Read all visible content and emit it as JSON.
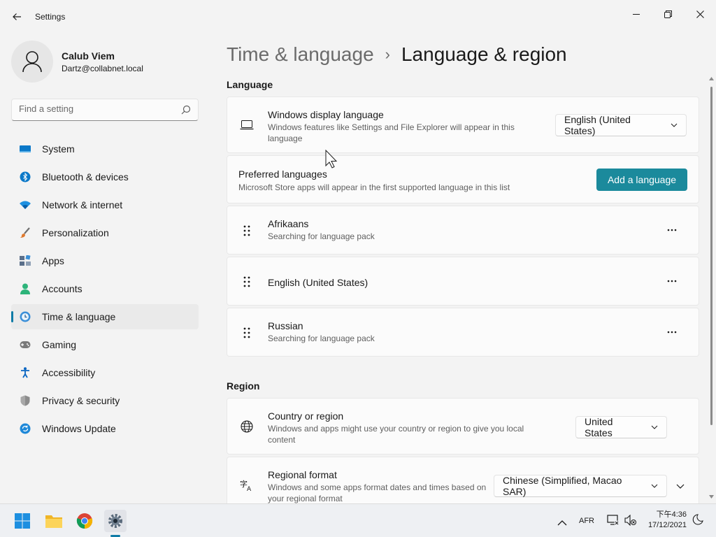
{
  "window": {
    "title": "Settings",
    "controls": {
      "minimize": "minimize",
      "maximize": "restore",
      "close": "close"
    }
  },
  "profile": {
    "name": "Calub Viem",
    "email": "Dartz@collabnet.local"
  },
  "search": {
    "placeholder": "Find a setting"
  },
  "sidebar": {
    "items": [
      {
        "label": "System",
        "icon": "system-icon",
        "color": "#0078d4"
      },
      {
        "label": "Bluetooth & devices",
        "icon": "bluetooth-icon",
        "color": "#0078d4"
      },
      {
        "label": "Network & internet",
        "icon": "wifi-icon",
        "color": "#0078d4"
      },
      {
        "label": "Personalization",
        "icon": "brush-icon",
        "color": "#d66a2b"
      },
      {
        "label": "Apps",
        "icon": "apps-icon",
        "color": "#5a6a7a"
      },
      {
        "label": "Accounts",
        "icon": "accounts-icon",
        "color": "#2bb673"
      },
      {
        "label": "Time & language",
        "icon": "clock-globe-icon",
        "color": "#0078d4",
        "active": true
      },
      {
        "label": "Gaming",
        "icon": "gamepad-icon",
        "color": "#6b6b6b"
      },
      {
        "label": "Accessibility",
        "icon": "accessibility-icon",
        "color": "#0a66c2"
      },
      {
        "label": "Privacy & security",
        "icon": "shield-icon",
        "color": "#8a8a8a"
      },
      {
        "label": "Windows Update",
        "icon": "update-icon",
        "color": "#0078d4"
      }
    ]
  },
  "breadcrumb": {
    "parent": "Time & language",
    "separator": "›",
    "current": "Language & region"
  },
  "language": {
    "section_title": "Language",
    "display_language": {
      "title": "Windows display language",
      "description": "Windows features like Settings and File Explorer will appear in this language",
      "value": "English (United States)"
    },
    "preferred": {
      "title": "Preferred languages",
      "description": "Microsoft Store apps will appear in the first supported language in this list",
      "add_button": "Add a language"
    },
    "languages": [
      {
        "name": "Afrikaans",
        "status": "Searching for language pack"
      },
      {
        "name": "English (United States)",
        "status": ""
      },
      {
        "name": "Russian",
        "status": "Searching for language pack"
      }
    ]
  },
  "region": {
    "section_title": "Region",
    "country": {
      "title": "Country or region",
      "description": "Windows and apps might use your country or region to give you local content",
      "value": "United States"
    },
    "format": {
      "title": "Regional format",
      "description": "Windows and some apps format dates and times based on your regional format",
      "value": "Chinese (Simplified, Macao SAR)"
    }
  },
  "taskbar": {
    "apps": [
      "start-icon",
      "file-explorer-icon",
      "chrome-icon",
      "settings-icon"
    ],
    "input_indicator": "AFR",
    "time": "下午4:36",
    "date": "17/12/2021"
  },
  "colors": {
    "accent": "#1b8a9c",
    "background": "#f3f3f3",
    "card": "#fbfbfb"
  }
}
